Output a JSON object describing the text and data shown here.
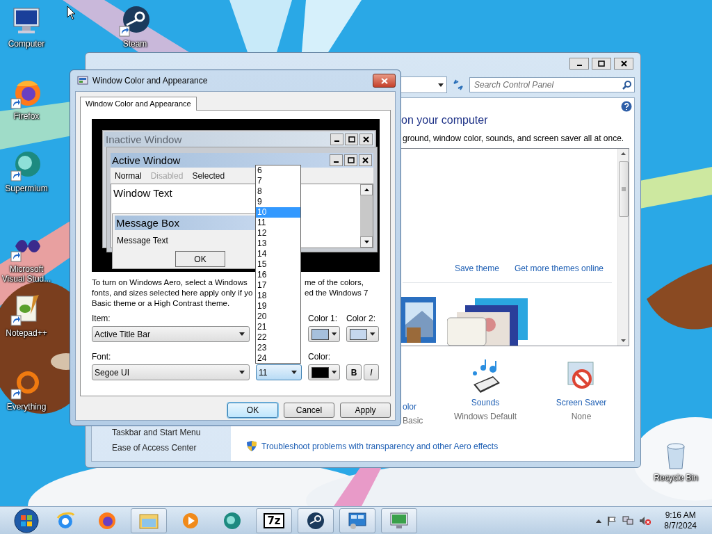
{
  "desktop_icons": [
    {
      "label": "Computer",
      "kind": "computer",
      "shortcut": false
    },
    {
      "label": "Steam",
      "kind": "steam",
      "shortcut": true
    },
    {
      "label": "Firefox",
      "kind": "firefox",
      "shortcut": true
    },
    {
      "label": "Supermium",
      "kind": "supermium",
      "shortcut": true
    },
    {
      "label": "Microsoft Visual Stud...",
      "kind": "visual-studio",
      "shortcut": true
    },
    {
      "label": "Notepad++",
      "kind": "notepad",
      "shortcut": true
    },
    {
      "label": "Everything",
      "kind": "everything",
      "shortcut": true
    },
    {
      "label": "Recycle Bin",
      "kind": "recycle-bin",
      "shortcut": false
    }
  ],
  "control_panel": {
    "search": {
      "placeholder": "Search Control Panel"
    },
    "heading": "on your computer",
    "description": "ground, window color, sounds, and screen saver all at once.",
    "theme_links": [
      "Save theme",
      "Get more themes online"
    ],
    "settings": [
      {
        "title": "olor",
        "value": "Basic",
        "kind": "color"
      },
      {
        "title": "Sounds",
        "value": "Windows Default",
        "kind": "sounds"
      },
      {
        "title": "Screen Saver",
        "value": "None",
        "kind": "screen-saver"
      }
    ],
    "sidebar_links": [
      "Taskbar and Start Menu",
      "Ease of Access Center"
    ],
    "footer_link": "Troubleshoot problems with transparency and other Aero effects"
  },
  "dialog": {
    "title": "Window Color and Appearance",
    "tabs": [
      {
        "label": "Window Color and Appearance",
        "selected": true
      }
    ],
    "preview": {
      "inactive_title": "Inactive Window",
      "active_title": "Active Window",
      "menu": [
        {
          "label": "Normal",
          "kind": "normal"
        },
        {
          "label": "Disabled",
          "kind": "disabled"
        },
        {
          "label": "Selected",
          "kind": "selected"
        }
      ],
      "window_text": "Window Text",
      "message_title": "Message Box",
      "message_text": "Message Text",
      "ok": "OK"
    },
    "info_lines": [
      {
        "left": "To turn on Windows Aero, select a Windows",
        "right": "me of the colors,"
      },
      {
        "left": "fonts, and sizes selected here apply only if yo",
        "right": "ed the Windows 7"
      },
      {
        "left": "Basic theme or a High Contrast theme."
      }
    ],
    "item": {
      "label": "Item:",
      "value": "Active Title Bar"
    },
    "color_1": {
      "label": "Color 1:",
      "color": "#a6c0dc"
    },
    "color_2": {
      "label": "Color 2:",
      "color": "#c5d7ee"
    },
    "font": {
      "label": "Font:",
      "value": "Segoe UI"
    },
    "size": {
      "value": "11"
    },
    "font_color": {
      "label": "Color:",
      "color": "#000000"
    },
    "bold": "B",
    "italic": "I",
    "size_list": [
      {
        "label": "6",
        "selected": false
      },
      {
        "label": "7",
        "selected": false
      },
      {
        "label": "8",
        "selected": false
      },
      {
        "label": "9",
        "selected": false
      },
      {
        "label": "10",
        "selected": true
      },
      {
        "label": "11",
        "selected": false
      },
      {
        "label": "12",
        "selected": false
      },
      {
        "label": "13",
        "selected": false
      },
      {
        "label": "14",
        "selected": false
      },
      {
        "label": "15",
        "selected": false
      },
      {
        "label": "16",
        "selected": false
      },
      {
        "label": "17",
        "selected": false
      },
      {
        "label": "18",
        "selected": false
      },
      {
        "label": "19",
        "selected": false
      },
      {
        "label": "20",
        "selected": false
      },
      {
        "label": "21",
        "selected": false
      },
      {
        "label": "22",
        "selected": false
      },
      {
        "label": "23",
        "selected": false
      },
      {
        "label": "24",
        "selected": false
      }
    ],
    "buttons": [
      {
        "label": "OK",
        "kind": "default"
      },
      {
        "label": "Cancel",
        "kind": "normal"
      },
      {
        "label": "Apply",
        "kind": "normal"
      }
    ]
  },
  "taskbar": {
    "apps": [
      {
        "kind": "ie",
        "open": false
      },
      {
        "kind": "firefox",
        "open": false
      },
      {
        "kind": "explorer",
        "open": true
      },
      {
        "kind": "media-player",
        "open": false
      },
      {
        "kind": "supermium",
        "open": false
      },
      {
        "kind": "archive",
        "open": true,
        "glyph": "7z"
      },
      {
        "kind": "steam",
        "open": true
      },
      {
        "kind": "control-panel",
        "open": true
      },
      {
        "kind": "display",
        "open": true
      }
    ],
    "clock": {
      "time": "9:16 AM",
      "date": "8/7/2024"
    }
  }
}
